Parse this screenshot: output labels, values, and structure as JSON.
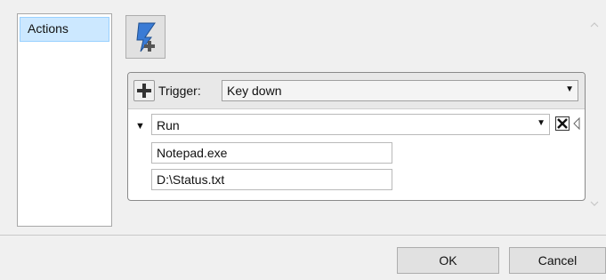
{
  "sidebar": {
    "items": [
      {
        "label": "Actions"
      }
    ]
  },
  "panel": {
    "trigger_label": "Trigger:",
    "trigger_value": "Key down",
    "action": {
      "value": "Run",
      "params": [
        "Notepad.exe",
        "D:\\Status.txt"
      ]
    }
  },
  "footer": {
    "ok_label": "OK",
    "cancel_label": "Cancel"
  },
  "icons": {
    "add_action": "lightning-plus-icon",
    "add_trigger": "plus-icon",
    "remove": "close-icon",
    "toggle": "triangle-down-icon",
    "dropdown": "chevron-down-icon"
  }
}
